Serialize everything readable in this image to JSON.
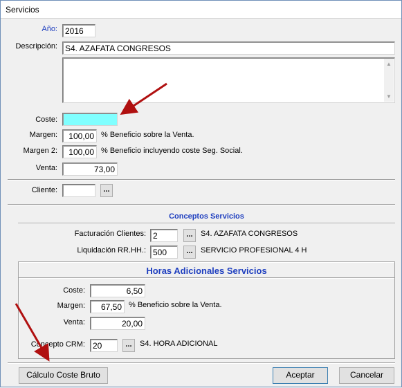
{
  "window": {
    "title": "Servicios"
  },
  "top": {
    "anio_label": "Año:",
    "anio_value": "2016",
    "descripcion_label": "Descripción:",
    "descripcion_value": "S4. AZAFATA CONGRESOS",
    "memo_value": ""
  },
  "pricing": {
    "coste_label": "Coste:",
    "coste_value": "",
    "margen_label": "Margen:",
    "margen_value": "100,00",
    "margen_desc": "% Beneficio sobre la Venta.",
    "margen2_label": "Margen 2:",
    "margen2_value": "100,00",
    "margen2_desc": "% Beneficio incluyendo coste Seg. Social.",
    "venta_label": "Venta:",
    "venta_value": "73,00"
  },
  "cliente": {
    "label": "Cliente:",
    "value": "",
    "lookup_label": "..."
  },
  "conceptos": {
    "title": "Conceptos Servicios",
    "facturacion_label": "Facturación Clientes:",
    "facturacion_value": "2",
    "facturacion_desc": "S4. AZAFATA CONGRESOS",
    "liquidacion_label": "Liquidación RR.HH.:",
    "liquidacion_value": "500",
    "liquidacion_desc": "SERVICIO PROFESIONAL 4 H",
    "lookup_label": "..."
  },
  "horas": {
    "title": "Horas Adicionales Servicios",
    "coste_label": "Coste:",
    "coste_value": "6,50",
    "margen_label": "Margen:",
    "margen_value": "67,50",
    "margen_desc": "% Beneficio sobre la Venta.",
    "venta_label": "Venta:",
    "venta_value": "20,00",
    "concepto_label": "Concepto CRM:",
    "concepto_value": "20",
    "concepto_desc": "S4. HORA ADICIONAL",
    "lookup_label": "..."
  },
  "buttons": {
    "calculo": "Cálculo Coste Bruto",
    "aceptar": "Aceptar",
    "cancelar": "Cancelar"
  },
  "colors": {
    "label_blue": "#1f3fbf",
    "highlight_cyan": "#80ffff",
    "arrow_red": "#b01010"
  },
  "icons": {
    "scroll_up": "▲",
    "scroll_down": "▼"
  }
}
